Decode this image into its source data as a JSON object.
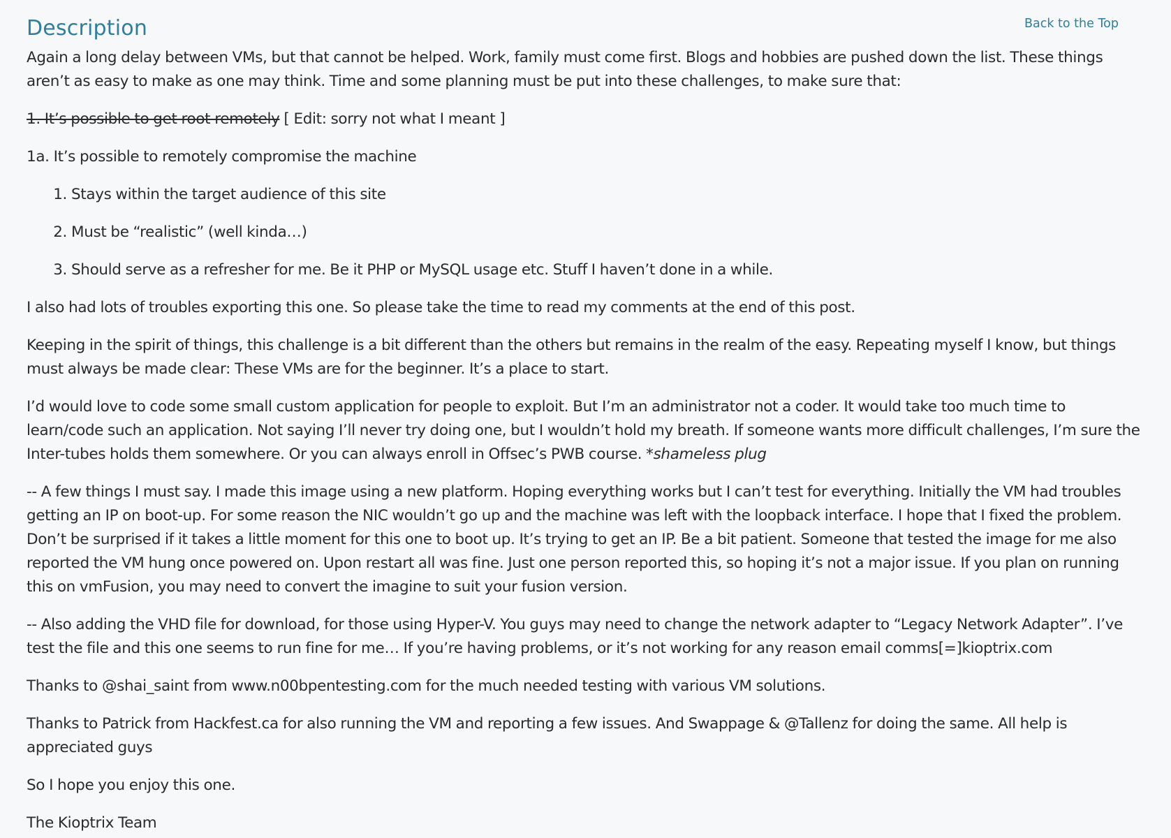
{
  "header": {
    "title": "Description",
    "back_link": "Back to the Top"
  },
  "content": {
    "intro": "Again a long delay between VMs, but that cannot be helped. Work, family must come first. Blogs and hobbies are pushed down the list. These things aren’t as easy to make as one may think. Time and some planning must be put into these challenges, to make sure that:",
    "struck_item": "1. It’s possible to get root remotely",
    "edit_note": " [ Edit: sorry not what I meant ]",
    "item_1a": "1a. It’s possible to remotely compromise the machine",
    "list_items": [
      "Stays within the target audience of this site",
      "Must be “realistic” (well kinda…)",
      "Should serve as a refresher for me. Be it PHP or MySQL usage etc. Stuff I haven’t done in a while."
    ],
    "para_exporting": "I also had lots of troubles exporting this one. So please take the time to read my comments at the end of this post.",
    "para_spirit": "Keeping in the spirit of things, this challenge is a bit different than the others but remains in the realm of the easy. Repeating myself I know, but things must always be made clear: These VMs are for the beginner. It’s a place to start.",
    "para_code": "I’d would love to code some small custom application for people to exploit. But I’m an administrator not a coder. It would take too much time to learn/code such an application. Not saying I’ll never try doing one, but I wouldn’t hold my breath. If someone wants more difficult challenges, I’m sure the Inter-tubes holds them somewhere. Or you can always enroll in Offsec’s PWB course. ",
    "para_code_plug": "*shameless plug",
    "para_platform": "-- A few things I must say. I made this image using a new platform. Hoping everything works but I can’t test for everything. Initially the VM had troubles getting an IP on boot-up. For some reason the NIC wouldn’t go up and the machine was left with the loopback interface. I hope that I fixed the problem. Don’t be surprised if it takes a little moment for this one to boot up. It’s trying to get an IP. Be a bit patient. Someone that tested the image for me also reported the VM hung once powered on. Upon restart all was fine. Just one person reported this, so hoping it’s not a major issue. If you plan on running this on vmFusion, you may need to convert the imagine to suit your fusion version.",
    "para_vhd": "-- Also adding the VHD file for download, for those using Hyper-V. You guys may need to change the network adapter to “Legacy Network Adapter”. I’ve test the file and this one seems to run fine for me… If you’re having problems, or it’s not working for any reason email comms[=]kioptrix.com",
    "para_thanks_shai": "Thanks to @shai_saint from www.n00bpentesting.com for the much needed testing with various VM solutions.",
    "para_thanks_patrick": "Thanks to Patrick from Hackfest.ca for also running the VM and reporting a few issues. And Swappage & @Tallenz for doing the same. All help is appreciated guys",
    "para_enjoy": "So I hope you enjoy this one.",
    "signature": "The Kioptrix Team"
  },
  "colors": {
    "accent": "#2e7f9c",
    "text": "#2b2b2b",
    "background": "#f6f8fa"
  }
}
